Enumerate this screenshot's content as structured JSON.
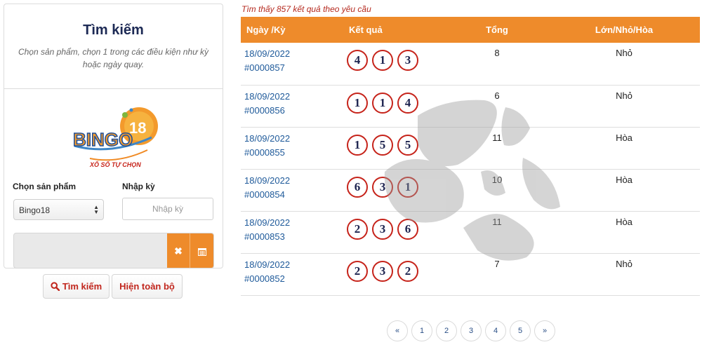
{
  "search": {
    "title": "Tìm kiếm",
    "hint": "Chọn sản phẩm, chọn 1 trong các điều kiện như kỳ hoặc ngày quay.",
    "logo": {
      "name": "BINGO",
      "number": "18",
      "tagline": "XỔ SỐ TỰ CHỌN"
    },
    "product_label": "Chọn sản phẩm",
    "product_value": "Bingo18",
    "period_label": "Nhập kỳ",
    "period_placeholder": "Nhập kỳ",
    "period_value": "",
    "date_value": "",
    "clear_icon": "✖",
    "search_button": "Tìm kiếm",
    "show_all_button": "Hiện toàn bộ"
  },
  "results": {
    "count_text": "Tìm thấy 857 kết quả theo yêu cầu",
    "headers": {
      "date": "Ngày /Kỳ",
      "result": "Kết quả",
      "total": "Tổng",
      "size": "Lớn/Nhỏ/Hòa"
    },
    "rows": [
      {
        "date": "18/09/2022",
        "draw": "#0000857",
        "balls": [
          "4",
          "1",
          "3"
        ],
        "total": "8",
        "size": "Nhỏ"
      },
      {
        "date": "18/09/2022",
        "draw": "#0000856",
        "balls": [
          "1",
          "1",
          "4"
        ],
        "total": "6",
        "size": "Nhỏ"
      },
      {
        "date": "18/09/2022",
        "draw": "#0000855",
        "balls": [
          "1",
          "5",
          "5"
        ],
        "total": "11",
        "size": "Hòa"
      },
      {
        "date": "18/09/2022",
        "draw": "#0000854",
        "balls": [
          "6",
          "3",
          "1"
        ],
        "total": "10",
        "size": "Hòa"
      },
      {
        "date": "18/09/2022",
        "draw": "#0000853",
        "balls": [
          "2",
          "3",
          "6"
        ],
        "total": "11",
        "size": "Hòa"
      },
      {
        "date": "18/09/2022",
        "draw": "#0000852",
        "balls": [
          "2",
          "3",
          "2"
        ],
        "total": "7",
        "size": "Nhỏ"
      }
    ]
  },
  "pagination": {
    "prev": "«",
    "pages": [
      "1",
      "2",
      "3",
      "4",
      "5"
    ],
    "next": "»"
  },
  "colors": {
    "accent": "#ee8b2b",
    "ball_border": "#c6231a",
    "link": "#1f5a9a"
  },
  "icons": {
    "clear": "close-icon",
    "calendar": "calendar-icon",
    "search": "search-icon",
    "select": "chevron-updown-icon",
    "watermark": "vietlott-watermark-icon"
  }
}
